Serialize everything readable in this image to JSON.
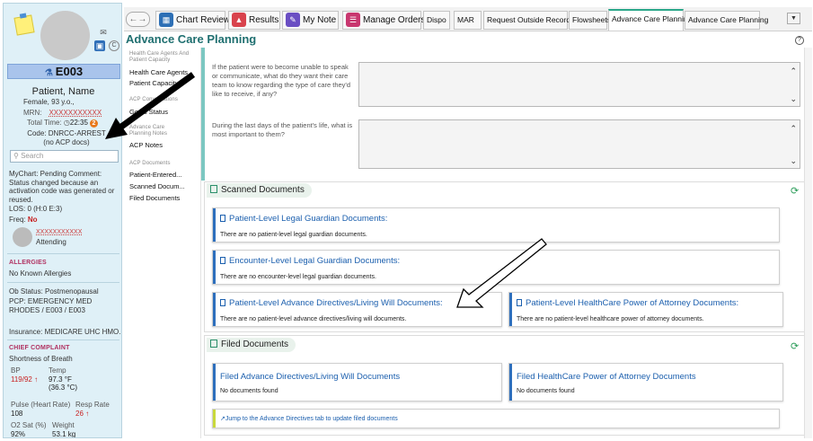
{
  "patient": {
    "id": "E003",
    "name": "Patient, Name",
    "sex_age": "Female, 93 y.o.,",
    "mrn_label": "MRN:",
    "mrn_value": "XXXXXXXXXXX",
    "total_time_label": "Total Time:",
    "total_time_value": "22:35",
    "total_time_badge": "2",
    "code_line1": "Code: DNRCC-ARREST",
    "code_line2": "(no ACP docs)",
    "search_placeholder": "Search",
    "mychart": "MyChart: Pending Comment: Status changed because an activation code was generated or reused.",
    "los": "LOS: 0 (H:0 E:3)",
    "freq_label": "Freq:",
    "freq_value": "No",
    "attending_name": "XXXXXXXXXXX",
    "attending_label": "Attending",
    "allergies_header": "ALLERGIES",
    "allergies_value": "No Known Allergies",
    "ob_status": "Ob Status: Postmenopausal",
    "pcp": "PCP: EMERGENCY MED RHODES / E003 / E003",
    "insurance": "Insurance: MEDICARE UHC HMO...",
    "cc_header": "CHIEF COMPLAINT",
    "cc_value": "Shortness of Breath",
    "vitals": {
      "bp_label": "BP",
      "bp_value": "119/92 ↑",
      "temp_label": "Temp",
      "temp_value": "97.3 °F",
      "temp_value2": "(36.3 °C)",
      "pulse_label": "Pulse (Heart Rate)",
      "pulse_value": "108",
      "resp_label": "Resp Rate",
      "resp_value": "26 ↑",
      "o2_label": "O2 Sat (%)",
      "o2_value": "92%",
      "wt_label": "Weight",
      "wt_value": "53.1 kg"
    }
  },
  "tabs": {
    "chart_review": "Chart Review",
    "results": "Results",
    "my_note": "My Note",
    "manage_orders": "Manage Orders",
    "dispo": "Dispo",
    "mar": "MAR",
    "request_outside": "Request Outside Records",
    "flowsheets": "Flowsheets",
    "acp_active": "Advance Care Planning",
    "acp_second": "Advance Care Planning"
  },
  "page": {
    "title": "Advance Care Planning",
    "help": "?"
  },
  "leftnav": {
    "h1": "Health Care Agents And Patient Capacity",
    "i1": "Health Care Agents",
    "i2": "Patient Capacity",
    "h2": "ACP Conversations",
    "i3": "Goals Status",
    "h3": "Advance Care Planning Notes",
    "i4": "ACP Notes",
    "h4": "ACP Documents",
    "i5": "Patient-Entered...",
    "i6": "Scanned Docum...",
    "i7": "Filed Documents"
  },
  "questions": {
    "q1": "If the patient were to become unable to speak or communicate, what do they want their care team to know regarding the type of care they'd like to receive, if any?",
    "q2": "During the last days of the patient's life, what is most important to them?"
  },
  "scanned": {
    "header": "Scanned Documents",
    "card1_title": "Patient-Level Legal Guardian Documents:",
    "card1_desc": "There are no patient-level legal guardian documents.",
    "card2_title": "Encounter-Level Legal Guardian Documents:",
    "card2_desc": "There are no encounter-level legal guardian documents.",
    "card3_title": "Patient-Level Advance Directives/Living Will Documents:",
    "card3_desc": "There are no patient-level advance directives/living will documents.",
    "card4_title": "Patient-Level HealthCare Power of Attorney Documents:",
    "card4_desc": "There are no patient-level healthcare power of attorney documents."
  },
  "filed": {
    "header": "Filed Documents",
    "card1_title": "Filed Advance Directives/Living Will Documents",
    "card1_desc": "No documents found",
    "card2_title": "Filed HealthCare Power of Attorney Documents",
    "card2_desc": "No documents found",
    "link": "Jump to the Advance Directives tab to update filed documents"
  }
}
